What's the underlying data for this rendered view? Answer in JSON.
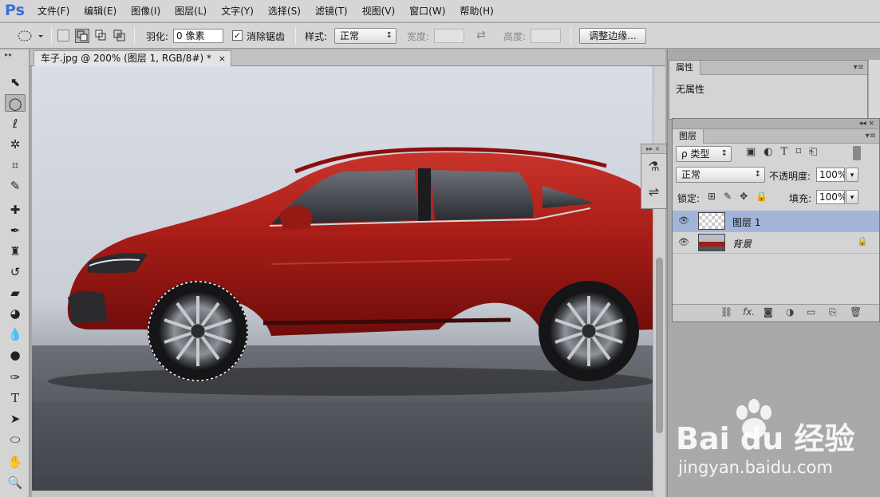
{
  "app": {
    "logo": "Ps"
  },
  "menu": [
    "文件(F)",
    "编辑(E)",
    "图像(I)",
    "图层(L)",
    "文字(Y)",
    "选择(S)",
    "滤镜(T)",
    "视图(V)",
    "窗口(W)",
    "帮助(H)"
  ],
  "options": {
    "feather_label": "羽化:",
    "feather_value": "0 像素",
    "antialias_label": "消除锯齿",
    "antialias_checked": true,
    "style_label": "样式:",
    "style_value": "正常",
    "width_label": "宽度:",
    "height_label": "高度:",
    "refine_edge_button": "调整边缘..."
  },
  "document": {
    "tab_title": "车子.jpg @ 200% (图层 1, RGB/8#) *",
    "close_glyph": "×"
  },
  "tools": [
    "move-tool",
    "elliptical-marquee-tool",
    "lasso-tool",
    "magic-wand-tool",
    "crop-tool",
    "eyedropper-tool",
    "spot-healing-tool",
    "brush-tool",
    "clone-stamp-tool",
    "history-brush-tool",
    "eraser-tool",
    "paint-bucket-tool",
    "blur-tool",
    "dodge-tool",
    "pen-tool",
    "type-tool",
    "path-selection-tool",
    "ellipse-shape-tool",
    "hand-tool",
    "zoom-tool"
  ],
  "active_tool": "elliptical-marquee-tool",
  "properties_panel": {
    "tab": "属性",
    "content": "无属性"
  },
  "layers_panel": {
    "tab": "图层",
    "filter_label": "ρ 类型",
    "blend_mode": "正常",
    "opacity_label": "不透明度:",
    "opacity_value": "100%",
    "lock_label": "锁定:",
    "fill_label": "填充:",
    "fill_value": "100%",
    "layers": [
      {
        "name": "图层 1",
        "selected": true,
        "visible": true,
        "locked": false
      },
      {
        "name": "背景",
        "selected": false,
        "visible": true,
        "locked": true
      }
    ],
    "footer_icons": [
      "link-icon",
      "fx-icon",
      "mask-icon",
      "adjustment-icon",
      "group-icon",
      "new-layer-icon",
      "trash-icon"
    ],
    "fx_text": "fx."
  },
  "watermark": {
    "brand": "Bai du 经验",
    "url": "jingyan.baidu.com"
  },
  "colors": {
    "chrome": "#d6d6d6",
    "selected_layer": "#a2b5d9",
    "car_body": "#b0231c"
  }
}
